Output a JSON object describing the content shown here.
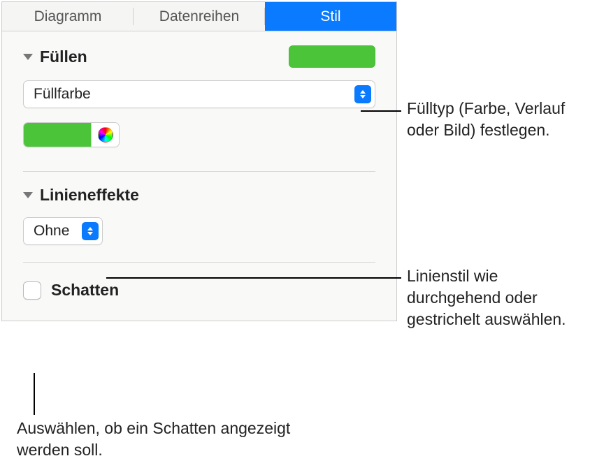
{
  "tabs": {
    "diagram": "Diagramm",
    "dataseries": "Datenreihen",
    "style": "Stil"
  },
  "fill": {
    "header": "Füllen",
    "select_label": "Füllfarbe",
    "swatch_color": "#4cc43a"
  },
  "line_effects": {
    "header": "Linieneffekte",
    "select_label": "Ohne"
  },
  "shadow": {
    "label": "Schatten",
    "checked": false
  },
  "annotations": {
    "fill_type": "Fülltyp (Farbe, Verlauf oder Bild) festlegen.",
    "line_style": "Linienstil wie durchgehend oder gestrichelt auswählen.",
    "shadow_pick": "Auswählen, ob ein Schatten angezeigt werden soll."
  }
}
